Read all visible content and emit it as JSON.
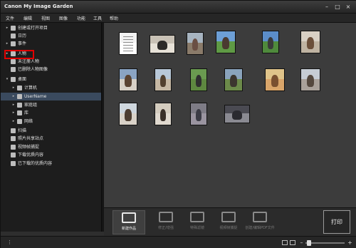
{
  "window": {
    "title": "Canon My Image Garden",
    "minimize": "–",
    "maximize": "□",
    "close": "×"
  },
  "menu": [
    "文件",
    "编辑",
    "视图",
    "图像",
    "功能",
    "工具",
    "帮助"
  ],
  "sidebar": {
    "items": [
      {
        "label": "创建或打开项目",
        "arrow": "▸",
        "icon": "folder-icon"
      },
      {
        "label": "日历",
        "arrow": "",
        "icon": "calendar-icon"
      },
      {
        "label": "事件",
        "arrow": "▸",
        "icon": "event-icon"
      },
      {
        "label": "人物",
        "arrow": "▸",
        "icon": "person-icon"
      },
      {
        "label": "未注册人物",
        "arrow": "",
        "icon": "unregistered-person-icon"
      },
      {
        "label": "已删除人物图像",
        "arrow": "",
        "icon": "deleted-person-icon"
      },
      {
        "label": "桌面",
        "arrow": "▾",
        "icon": "desktop-icon"
      },
      {
        "label": "计算机",
        "arrow": "▸",
        "icon": "computer-icon"
      },
      {
        "label": "UserName",
        "arrow": "▸",
        "icon": "user-folder-icon"
      },
      {
        "label": "家庭组",
        "arrow": "▸",
        "icon": "homegroup-icon"
      },
      {
        "label": "库",
        "arrow": "▸",
        "icon": "library-icon"
      },
      {
        "label": "网络",
        "arrow": "▸",
        "icon": "network-icon"
      },
      {
        "label": "扫描",
        "arrow": "",
        "icon": "scan-icon"
      },
      {
        "label": "照片共享站点",
        "arrow": "",
        "icon": "photo-sharing-icon"
      },
      {
        "label": "视频帧捕捉",
        "arrow": "",
        "icon": "video-frame-icon"
      },
      {
        "label": "下载优质内容",
        "arrow": "",
        "icon": "download-icon"
      },
      {
        "label": "已下载的优质内容",
        "arrow": "",
        "icon": "downloaded-folder-icon"
      }
    ]
  },
  "toolbar": {
    "items": [
      {
        "label": "新建作品",
        "icon": "new-item-icon",
        "enabled": true
      },
      {
        "label": "修正/增强",
        "icon": "correct-enhance-icon",
        "enabled": false
      },
      {
        "label": "特殊滤镜",
        "icon": "special-filters-icon",
        "enabled": false
      },
      {
        "label": "视频帧捕捉",
        "icon": "video-capture-icon",
        "enabled": false
      },
      {
        "label": "创建/编辑PDF文件",
        "icon": "pdf-icon",
        "enabled": false
      }
    ],
    "print_label": "打印"
  },
  "statusbar": {
    "menu_dots": "⋮",
    "zoom_minus": "–",
    "zoom_plus": "+",
    "zoom_level": 0.05
  },
  "thumbnails": [
    {
      "kind": "document",
      "sky": "#f2f2f2",
      "ground": "#ffffff",
      "kid": "#9a9a9a"
    },
    {
      "kind": "photo",
      "sky": "#c9c2b6",
      "ground": "#e7e2d8",
      "kid": "#2c2a28"
    },
    {
      "kind": "photo",
      "sky": "#a7b4c0",
      "ground": "#8a7b6a",
      "kid": "#6a4f44"
    },
    {
      "kind": "photo",
      "sky": "#6d9fd6",
      "ground": "#5f9a45",
      "kid": "#4a3a30"
    },
    {
      "kind": "photo",
      "sky": "#5b8dc9",
      "ground": "#4f8a3c",
      "kid": "#3a3a3a"
    },
    {
      "kind": "photo",
      "sky": "#d8d0c4",
      "ground": "#bfb3a2",
      "kid": "#6b4f3a"
    },
    {
      "kind": "photo",
      "sky": "#8aa4c4",
      "ground": "#d7d0c6",
      "kid": "#5a4332"
    },
    {
      "kind": "photo",
      "sky": "#b8c8d8",
      "ground": "#c6b8a4",
      "kid": "#52402f"
    },
    {
      "kind": "photo",
      "sky": "#6a9a50",
      "ground": "#5e8840",
      "kid": "#2f2f2f"
    },
    {
      "kind": "photo",
      "sky": "#8aa3bc",
      "ground": "#6c8a4a",
      "kid": "#3c352f"
    },
    {
      "kind": "photo",
      "sky": "#e0c48a",
      "ground": "#d9a56a",
      "kid": "#7a5030"
    },
    {
      "kind": "photo",
      "sky": "#c6ccd4",
      "ground": "#a9a19a",
      "kid": "#54483e"
    },
    {
      "kind": "photo",
      "sky": "#cfd7de",
      "ground": "#d9d2c8",
      "kid": "#4d3d30"
    },
    {
      "kind": "photo",
      "sky": "#d4ccbf",
      "ground": "#e0d9cf",
      "kid": "#3a3029"
    },
    {
      "kind": "photo",
      "sky": "#7e7c86",
      "ground": "#9a94a0",
      "kid": "#3b3b45"
    },
    {
      "kind": "photo",
      "sky": "#4a4a52",
      "ground": "#8a8a92",
      "kid": "#2a2a30"
    }
  ]
}
